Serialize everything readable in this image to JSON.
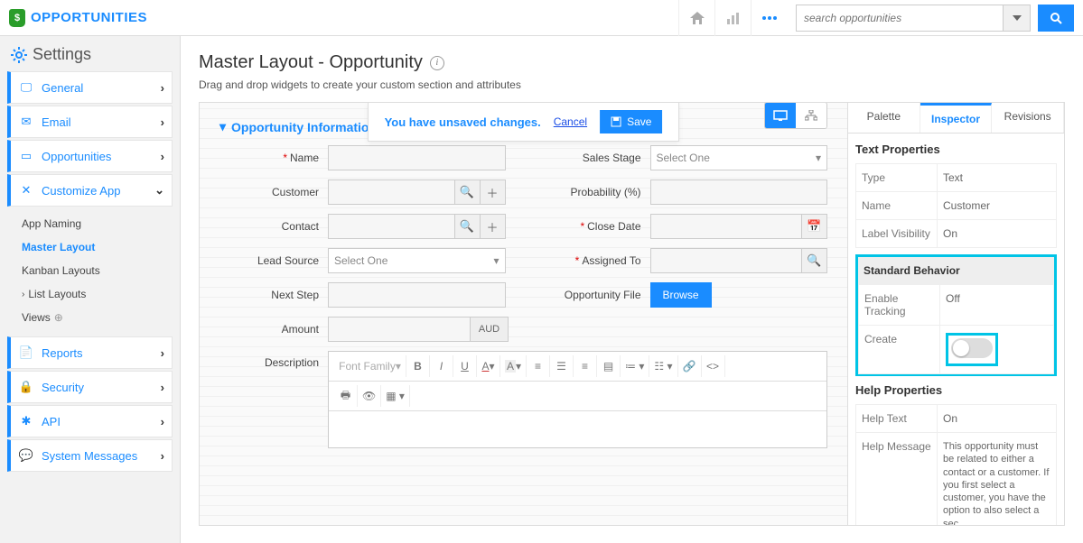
{
  "app": {
    "name": "OPPORTUNITIES"
  },
  "search": {
    "placeholder": "search opportunities"
  },
  "sidebar": {
    "title": "Settings",
    "items": [
      {
        "label": "General"
      },
      {
        "label": "Email"
      },
      {
        "label": "Opportunities"
      },
      {
        "label": "Customize App"
      },
      {
        "label": "Reports"
      },
      {
        "label": "Security"
      },
      {
        "label": "API"
      },
      {
        "label": "System Messages"
      }
    ],
    "sub": {
      "app_naming": "App Naming",
      "master_layout": "Master Layout",
      "kanban_layouts": "Kanban Layouts",
      "list_layouts": "List Layouts",
      "views": "Views"
    }
  },
  "page": {
    "title": "Master Layout - Opportunity",
    "subtitle": "Drag and drop widgets to create your custom section and attributes"
  },
  "banner": {
    "message": "You have unsaved changes.",
    "cancel": "Cancel",
    "save": "Save"
  },
  "section": {
    "title": "Opportunity Information"
  },
  "fields": {
    "name": "Name",
    "customer": "Customer",
    "contact": "Contact",
    "lead_source": "Lead Source",
    "lead_source_sel": "Select One",
    "next_step": "Next Step",
    "amount": "Amount",
    "amount_cur": "AUD",
    "description": "Description",
    "sales_stage": "Sales Stage",
    "sales_stage_sel": "Select One",
    "probability": "Probability (%)",
    "close_date": "Close Date",
    "assigned_to": "Assigned To",
    "opp_file": "Opportunity File",
    "browse": "Browse",
    "font_family": "Font Family"
  },
  "inspector": {
    "tabs": {
      "palette": "Palette",
      "inspector": "Inspector",
      "revisions": "Revisions"
    },
    "text_props": "Text Properties",
    "type": {
      "k": "Type",
      "v": "Text"
    },
    "name": {
      "k": "Name",
      "v": "Customer"
    },
    "label_vis": {
      "k": "Label Visibility",
      "v": "On"
    },
    "std_behavior": "Standard Behavior",
    "enable_tracking": {
      "k": "Enable Tracking",
      "v": "Off"
    },
    "create": "Create",
    "help_props": "Help Properties",
    "help_text": {
      "k": "Help Text",
      "v": "On"
    },
    "help_msg": {
      "k": "Help Message",
      "v": "This opportunity must be related to either a contact or a customer. If you first select a customer, you have the option to also select a sec"
    }
  }
}
